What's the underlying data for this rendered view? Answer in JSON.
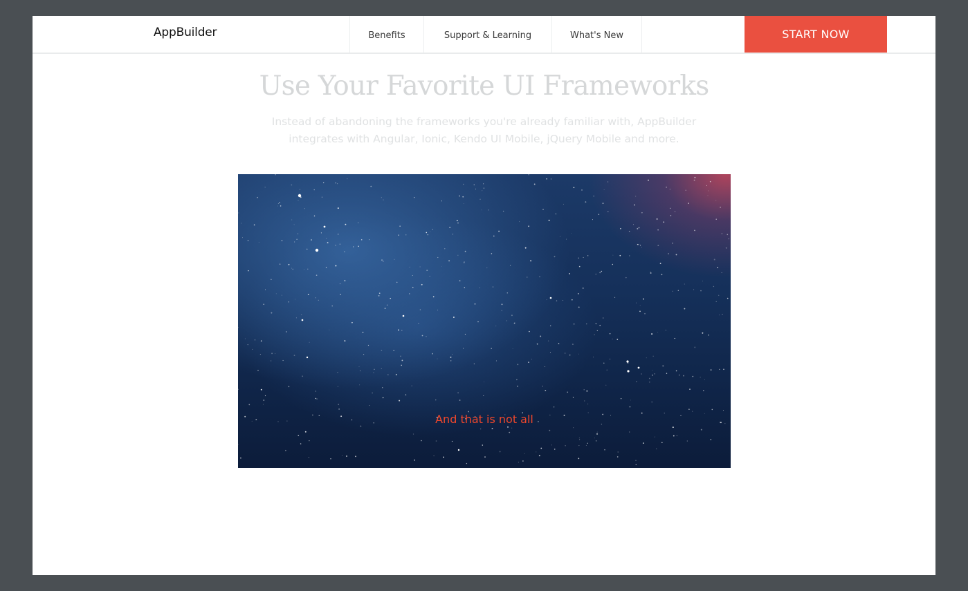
{
  "header": {
    "brand": "AppBuilder",
    "nav": [
      {
        "label": "Benefits"
      },
      {
        "label": "Support & Learning"
      },
      {
        "label": "What's New"
      }
    ],
    "cta_label": "START NOW"
  },
  "hero": {
    "title": "Use Your Favorite UI Frameworks",
    "subtitle": "Instead of abandoning the frameworks you're already familiar with, AppBuilder integrates with Angular, Ionic, Kendo UI Mobile, jQuery Mobile and more."
  },
  "media": {
    "caption": "And that is not all"
  },
  "colors": {
    "frame": "#4a4f53",
    "accent": "#ea5040",
    "caption": "#f0472b",
    "title": "#d5d7d8"
  }
}
